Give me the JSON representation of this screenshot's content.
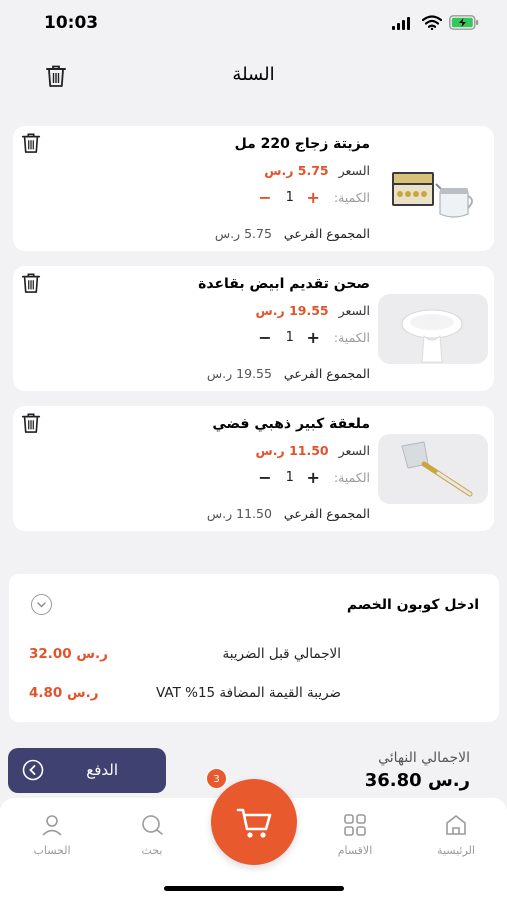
{
  "status_bar": {
    "time": "10:03"
  },
  "header": {
    "title": "السلة",
    "clear_icon": "trash-icon"
  },
  "items": [
    {
      "title": "مزيتة زجاج 220 مل",
      "price_label": "السعر",
      "price": "5.75 ر.س",
      "qty_label": "الكمية:",
      "qty": "1",
      "subtotal_label": "المجموع الفرعي",
      "subtotal": "5.75 ر.س"
    },
    {
      "title": "صحن تقديم ابيض بقاعدة",
      "price_label": "السعر",
      "price": "19.55 ر.س",
      "qty_label": "الكمية:",
      "qty": "1",
      "subtotal_label": "المجموع الفرعي",
      "subtotal": "19.55 ر.س"
    },
    {
      "title": "ملعقة كبير ذهبي فضي",
      "price_label": "السعر",
      "price": "11.50 ر.س",
      "qty_label": "الكمية:",
      "qty": "1",
      "subtotal_label": "المجموع الفرعي",
      "subtotal": "11.50 ر.س"
    }
  ],
  "summary": {
    "coupon_label": "ادخل كوبون الخصم",
    "pretax_label": "الاجمالي قبل الضريبة",
    "pretax_value": "32.00 ر.س",
    "vat_label": "ضريبة القيمة المضافة 15% VAT",
    "vat_value": "4.80 ر.س"
  },
  "checkout": {
    "total_label": "الاجمالي النهائي",
    "total_value": "36.80 ر.س",
    "pay_label": "الدفع"
  },
  "tab_bar": {
    "cart_badge": "3",
    "tabs": [
      {
        "label": "الحساب",
        "icon": "person-icon"
      },
      {
        "label": "بحث",
        "icon": "search-icon"
      },
      {
        "label": "الاقسام",
        "icon": "grid-icon"
      },
      {
        "label": "الرئيسية",
        "icon": "home-icon"
      }
    ]
  },
  "colors": {
    "accent": "#e3532b",
    "pay_button": "#3f4170",
    "background": "#f2f2f4"
  }
}
